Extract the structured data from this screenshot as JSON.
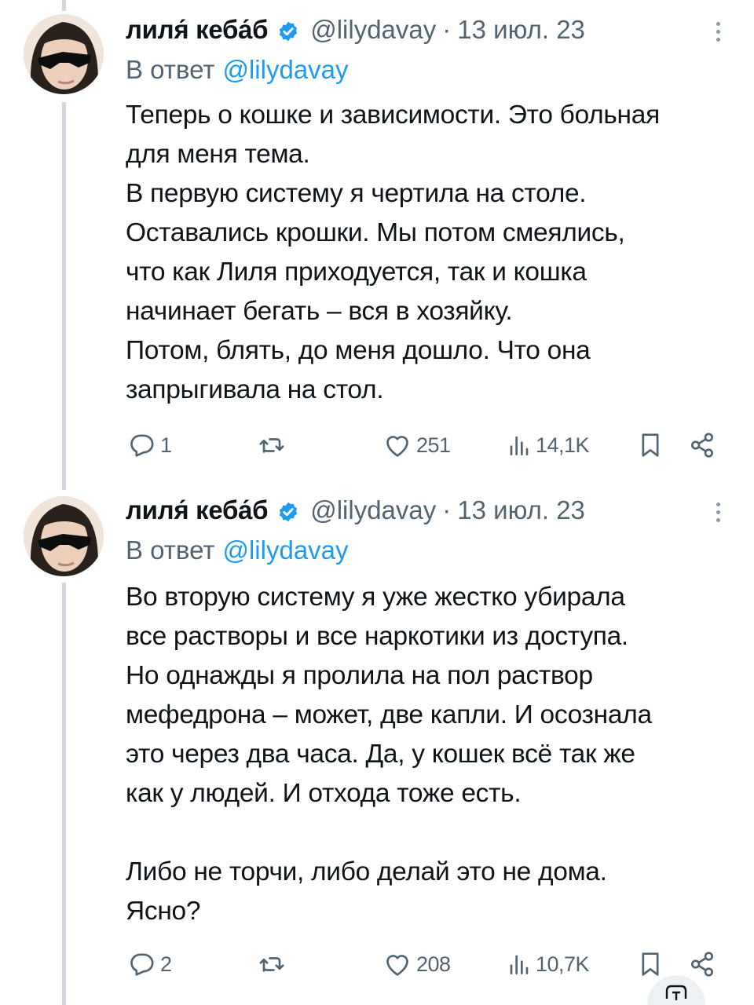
{
  "tweets": [
    {
      "author_name": "лиля́ кеба́б",
      "handle": "@lilydavay",
      "separator": "·",
      "date": "13 июл. 23",
      "reply_label": "В ответ",
      "reply_mention": "@lilydavay",
      "text": "Теперь о кошке и зависимости. Это больная\nдля меня тема.\nВ первую систему я чертила на столе.\nОставались крошки. Мы потом смеялись,\nчто как Лиля приходуется, так и кошка\nначинает бегать – вся в хозяйку.\nПотом, блять, до меня дошло. Что она\nзапрыгивала на стол.",
      "replies": "1",
      "retweets": "",
      "likes": "251",
      "views": "14,1K"
    },
    {
      "author_name": "лиля́ кеба́б",
      "handle": "@lilydavay",
      "separator": "·",
      "date": "13 июл. 23",
      "reply_label": "В ответ",
      "reply_mention": "@lilydavay",
      "text": "Во вторую систему я уже жестко убирала\nвсе растворы и все наркотики из доступа.\nНо однажды я пролила на пол раствор\nмефедрона – может, две капли. И осознала\nэто через два часа. Да, у кошек всё так же\nкак у людей. И отхода тоже есть.\n\nЛибо не торчи, либо делай это не дома.\nЯсно?",
      "replies": "2",
      "retweets": "",
      "likes": "208",
      "views": "10,7K"
    }
  ],
  "icons": {
    "verified": "verified-badge-icon",
    "reply": "reply-icon",
    "retweet": "retweet-icon",
    "like": "heart-icon",
    "views": "views-chart-icon",
    "bookmark": "bookmark-icon",
    "share": "share-icon",
    "more": "more-dots-icon",
    "compose": "compose-icon"
  },
  "colors": {
    "accent": "#1d9bf0",
    "secondary_text": "#536471",
    "primary_text": "#0f1419",
    "thread_line": "#cfd9de"
  }
}
